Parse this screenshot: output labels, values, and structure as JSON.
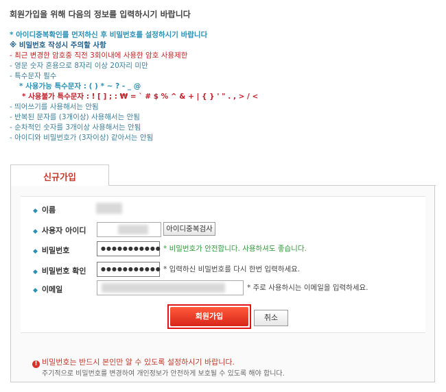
{
  "intro": "회원가입을 위해 다음의 정보를 입력하시기 바랍니다",
  "rules": {
    "r1": "* 아이디중복확인를 먼저하신 후 비밀번호를 설정하시기 바랍니다",
    "r2": "※ 비밀번호 작성시 주의할 사항",
    "r3": "- 최근 변경한 암호중 직전 3회이내에 사용한 암호 사용제한",
    "r4": "- 영문 숫자 혼용으로 8자리 이상 20자리 미만",
    "r5": "- 특수문자 필수",
    "r6": "* 사용가능 특수문자 : ( ) * ~ ? - _ @",
    "r7": "* 사용불가 특수문자 : ! [ ] ; : ₩ = ` # $ % ^ & + | { } ' \" . , > / <",
    "r8": "- 띄어쓰기를 사용해서는 안됨",
    "r9": "- 반복된 문자를 (3개이상) 사용해서는 안됨",
    "r10": "- 순차적인 숫자를 3개이상 사용해서는 안됨",
    "r11": "- 아이디와 비밀번호가 (3자이상) 같아서는 안됨"
  },
  "tab": {
    "label": "신규가입"
  },
  "form": {
    "bullet": "◆",
    "name_label": "이름",
    "userid_label": "사용자 아이디",
    "dup_check_button": "아이디중복검사",
    "password_label": "비밀번호",
    "password_value": "●●●●●●●●●●●",
    "password_hint": "* 비밀번호가 안전합니다. 사용하셔도 좋습니다.",
    "password_confirm_label": "비밀번호 확인",
    "password_confirm_value": "●●●●●●●●●●●",
    "password_confirm_hint": "* 입력하신 비밀번호를 다시 한번 입력하세요.",
    "email_label": "이메일",
    "email_hint": "* 주로 사용하시는 이메일을 입력하세요."
  },
  "buttons": {
    "join": "회원가입",
    "cancel": "취소"
  },
  "notice": {
    "icon": "!",
    "line1": "비밀번호는 반드시 본인만 알 수 있도록 설정하시기 바랍니다.",
    "line2": "주기적으로 비밀번호를 변경하여 개인정보가 안전하게 보호될 수 있도록 해야 합니다."
  },
  "colors": {
    "accent_red": "#c0392b",
    "link_blue": "#2a8fb5",
    "success_green": "#2e9a3a",
    "button_red": "#e21212"
  }
}
